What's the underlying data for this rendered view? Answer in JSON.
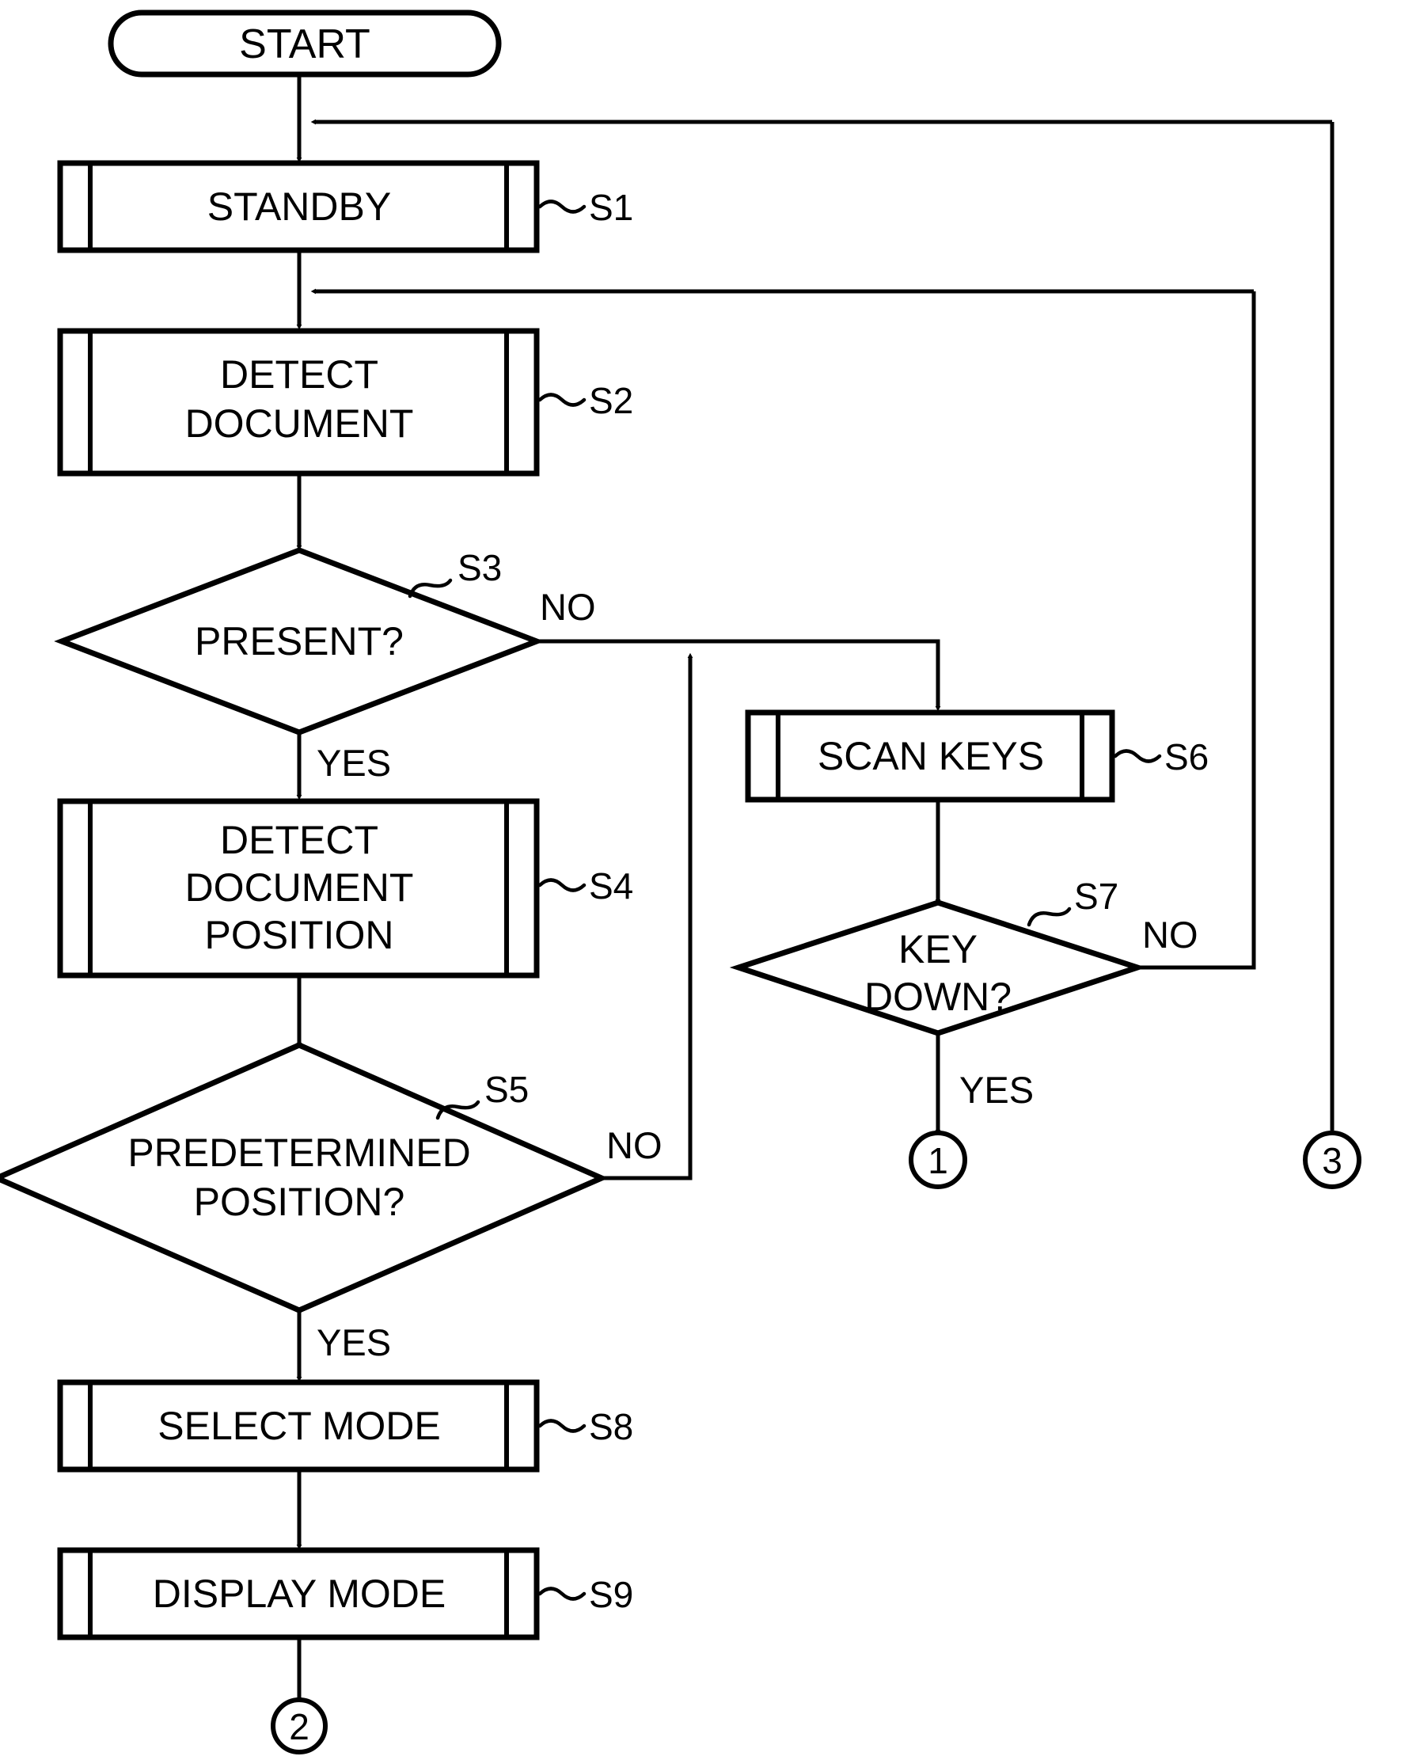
{
  "figure": {
    "type": "flowchart",
    "title": "START",
    "orientation": "top-to-bottom"
  },
  "nodes": {
    "start": {
      "label": "START",
      "shape": "terminator"
    },
    "s1": {
      "label": "STANDBY",
      "step": "S1",
      "shape": "predefined-process"
    },
    "s2": {
      "label_line1": "DETECT",
      "label_line2": "DOCUMENT",
      "step": "S2",
      "shape": "predefined-process"
    },
    "s3": {
      "label": "PRESENT?",
      "step": "S3",
      "shape": "decision"
    },
    "s4": {
      "label_line1": "DETECT",
      "label_line2": "DOCUMENT",
      "label_line3": "POSITION",
      "step": "S4",
      "shape": "predefined-process"
    },
    "s5": {
      "label_line1": "PREDETERMINED",
      "label_line2": "POSITION?",
      "step": "S5",
      "shape": "decision"
    },
    "s6": {
      "label": "SCAN KEYS",
      "step": "S6",
      "shape": "predefined-process"
    },
    "s7": {
      "label_line1": "KEY",
      "label_line2": "DOWN?",
      "step": "S7",
      "shape": "decision"
    },
    "s8": {
      "label": "SELECT MODE",
      "step": "S8",
      "shape": "predefined-process"
    },
    "s9": {
      "label": "DISPLAY MODE",
      "step": "S9",
      "shape": "predefined-process"
    }
  },
  "branch_labels": {
    "s3_no": "NO",
    "s3_yes": "YES",
    "s5_no": "NO",
    "s5_yes": "YES",
    "s7_no": "NO",
    "s7_yes": "YES"
  },
  "connectors": {
    "one": "1",
    "two": "2",
    "three": "3"
  },
  "colors": {
    "stroke": "#000000",
    "fill": "#ffffff",
    "background": "#ffffff"
  }
}
